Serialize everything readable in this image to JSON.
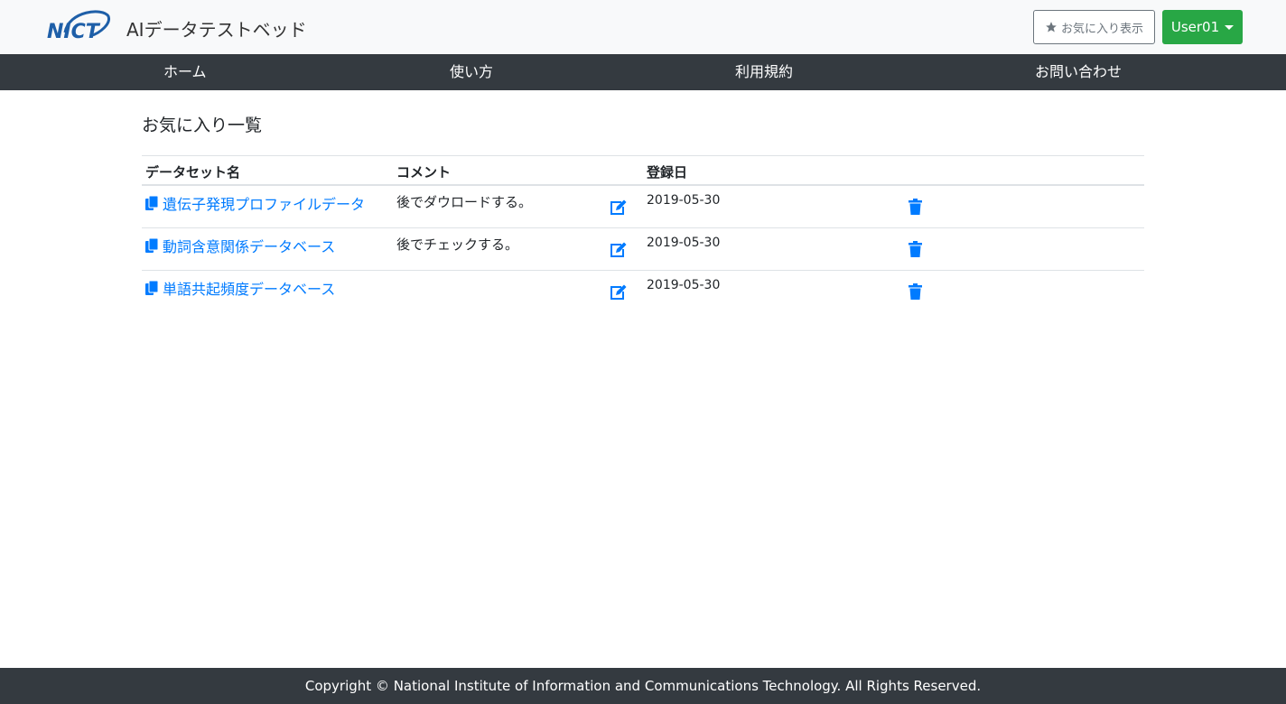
{
  "header": {
    "logo_text": "NICT",
    "app_title": "AIデータテストベッド",
    "favorites_button": "お気に入り表示",
    "user_menu": "User01"
  },
  "nav": {
    "items": [
      {
        "label": "ホーム"
      },
      {
        "label": "使い方"
      },
      {
        "label": "利用規約"
      },
      {
        "label": "お問い合わせ"
      }
    ]
  },
  "main": {
    "heading": "お気に入り一覧",
    "table": {
      "columns": [
        "データセット名",
        "コメント",
        "登録日"
      ],
      "rows": [
        {
          "name": "遺伝子発現プロファイルデータ",
          "comment": "後でダウロードする。",
          "date": "2019-05-30"
        },
        {
          "name": "動詞含意関係データベース",
          "comment": "後でチェックする。",
          "date": "2019-05-30"
        },
        {
          "name": "単語共起頻度データベース",
          "comment": "",
          "date": "2019-05-30"
        }
      ]
    }
  },
  "footer": {
    "copyright": "Copyright © National Institute of Information and Communications Technology. All Rights Reserved."
  },
  "colors": {
    "nav_bg": "#343a40",
    "link": "#007bff",
    "user_button": "#28a745",
    "topbar_bg": "#f8f9fa"
  },
  "icons": [
    "star-icon",
    "copy-icon",
    "edit-icon",
    "trash-icon",
    "caret-down-icon"
  ]
}
